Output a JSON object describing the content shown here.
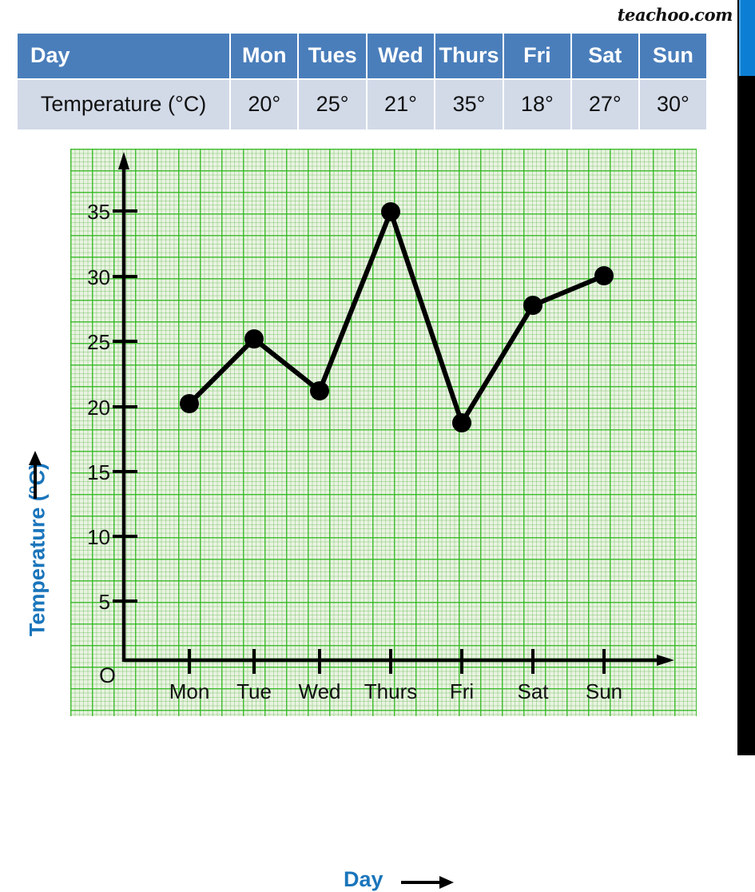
{
  "watermark": "teachoo.com",
  "table": {
    "row_header_day": "Day",
    "row_header_temp": "Temperature (°C)",
    "days": [
      "Mon",
      "Tues",
      "Wed",
      "Thurs",
      "Fri",
      "Sat",
      "Sun"
    ],
    "temperatures": [
      "20°",
      "25°",
      "21°",
      "35°",
      "18°",
      "27°",
      "30°"
    ]
  },
  "chart_data": {
    "type": "line",
    "title": "",
    "xlabel": "Day",
    "ylabel": "Temperature (°C)",
    "categories": [
      "Mon",
      "Tue",
      "Wed",
      "Thurs",
      "Fri",
      "Sat",
      "Sun"
    ],
    "values": [
      20,
      25,
      21,
      35,
      18,
      27,
      30
    ],
    "y_ticks": [
      5,
      10,
      15,
      20,
      25,
      30,
      35
    ],
    "ylim": [
      0,
      38
    ],
    "origin_label": "O",
    "grid": "graph-paper",
    "legend": "none",
    "marker": "filled-circle",
    "line_color": "#000000",
    "axis_label_color": "#1a75bb",
    "paper_color": "#eaf3e2",
    "grid_color": "#2dbe1e"
  },
  "colors": {
    "table_header_bg": "#4a7ebb",
    "table_header_text": "#ffffff",
    "table_row_bg": "#d2dae8",
    "accent_blue": "#1a75bb",
    "edge_stripe_blue": "#0c7fd4",
    "edge_stripe_black": "#000000"
  }
}
